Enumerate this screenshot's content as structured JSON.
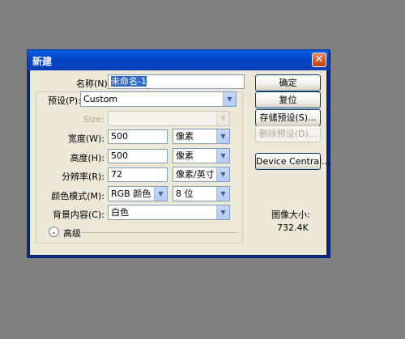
{
  "dialog": {
    "title": "新建",
    "close_glyph": "✕"
  },
  "fields": {
    "name_label": "名称(N):",
    "name_value": "未命名-1",
    "preset_label": "预设(P):",
    "preset_value": "Custom",
    "size_label": "Size:",
    "size_value": "",
    "width_label": "宽度(W):",
    "width_value": "500",
    "width_unit": "像素",
    "height_label": "高度(H):",
    "height_value": "500",
    "height_unit": "像素",
    "resolution_label": "分辨率(R):",
    "resolution_value": "72",
    "resolution_unit": "像素/英寸",
    "color_mode_label": "颜色模式(M):",
    "color_mode_value": "RGB 颜色",
    "bit_depth_value": "8 位",
    "background_label": "背景内容(C):",
    "background_value": "白色",
    "advanced_label": "高级"
  },
  "buttons": {
    "ok": "确定",
    "reset": "复位",
    "save_preset": "存储预设(S)...",
    "delete_preset": "删除预设(D)...",
    "device_central": "Device Central..."
  },
  "info": {
    "image_size_label": "图像大小:",
    "image_size_value": "732.4K"
  },
  "icons": {
    "dropdown": "▼",
    "expand": "⌄"
  },
  "colors": {
    "titlebar": "#0a5fe0",
    "dialog_bg": "#ece9d8",
    "desktop": "#808080",
    "selection": "#316ac5"
  }
}
